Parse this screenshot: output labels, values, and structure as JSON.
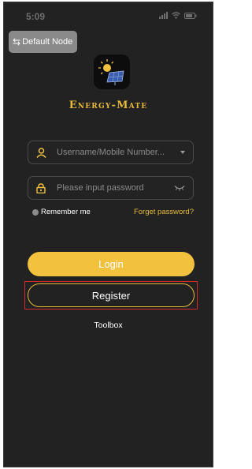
{
  "status_bar": {
    "time": "5:09"
  },
  "header": {
    "node_label": "Default Node",
    "node_icon": "swap-arrows-icon"
  },
  "brand": {
    "name": "Energy-Mate",
    "logo_icon": "solar-panel-sun-icon"
  },
  "form": {
    "username_placeholder": "Username/Mobile Number...",
    "password_placeholder": "Please input password",
    "remember_label": "Remember me",
    "forgot_label": "Forget password?"
  },
  "actions": {
    "login_label": "Login",
    "register_label": "Register",
    "toolbox_label": "Toolbox"
  },
  "colors": {
    "background": "#222222",
    "accent": "#f2c23f",
    "brand_text": "#e8b93a",
    "highlight_box": "#d62a2a"
  }
}
